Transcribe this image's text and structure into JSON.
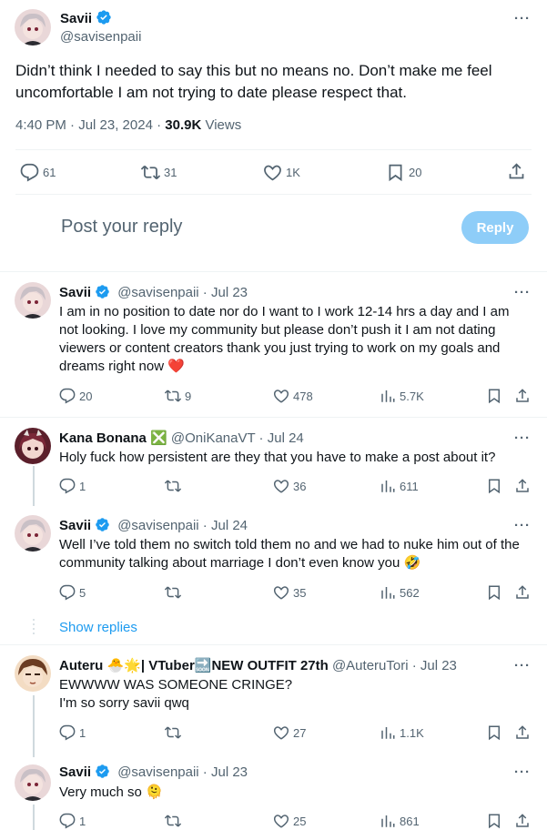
{
  "main": {
    "name": "Savii",
    "handle": "@savisenpaii",
    "text": "Didn’t think I needed to say this but no means no. Don’t make me feel uncomfortable I am not trying to date please respect that.",
    "time": "4:40 PM · Jul 23, 2024 · ",
    "views": "30.9K",
    "views_label": " Views",
    "stats": {
      "replies": "61",
      "reposts": "31",
      "likes": "1K",
      "bookmarks": "20"
    }
  },
  "composer": {
    "placeholder": "Post your reply",
    "button": "Reply"
  },
  "replies": [
    {
      "name": "Savii",
      "handle": "@savisenpaii",
      "date": " · Jul 23",
      "text": "I am in no position to date nor do I want to I work 12-14 hrs a day and I am not looking. I love my community but please don’t push it I am not dating viewers or content creators thank you just trying to work on my goals and dreams right now ❤️",
      "replies": "20",
      "reposts": "9",
      "likes": "478",
      "views": "5.7K"
    },
    {
      "name": "Kana Bonana",
      "badge": "❎",
      "handle": "@OniKanaVT",
      "date": " · Jul 24",
      "text": "Holy fuck how persistent are they that you have to make a post about it?",
      "replies": "1",
      "reposts": "",
      "likes": "36",
      "views": "611"
    },
    {
      "name": "Savii",
      "handle": "@savisenpaii",
      "date": " · Jul 24",
      "text": "Well I’ve told them no switch told them no and we had to nuke him out of the community talking about marriage I don’t even know you 🤣",
      "replies": "5",
      "reposts": "",
      "likes": "35",
      "views": "562"
    },
    {
      "name": "Auteru 🐣🌟| VTuber🔜NEW OUTFIT 27th",
      "handle": "@AuteruTori",
      "date": " · Jul 23",
      "text_line1": "EWWWW WAS SOMEONE CRINGE?",
      "text_line2": "I'm so sorry savii qwq",
      "replies": "1",
      "reposts": "",
      "likes": "27",
      "views": "1.1K"
    },
    {
      "name": "Savii",
      "handle": "@savisenpaii",
      "date": " · Jul 23",
      "text": "Very much so 🫠",
      "replies": "1",
      "reposts": "",
      "likes": "25",
      "views": "861"
    }
  ],
  "show_replies": "Show replies",
  "more": "···",
  "colors": {
    "accent": "#1d9bf0",
    "reply_button": "#8ecdf8",
    "secondary_text": "#536471",
    "heart": "#e0245e"
  },
  "icons": [
    "comment-icon",
    "repost-icon",
    "like-icon",
    "bookmark-icon",
    "share-icon",
    "views-icon",
    "verified-icon",
    "more-icon"
  ]
}
